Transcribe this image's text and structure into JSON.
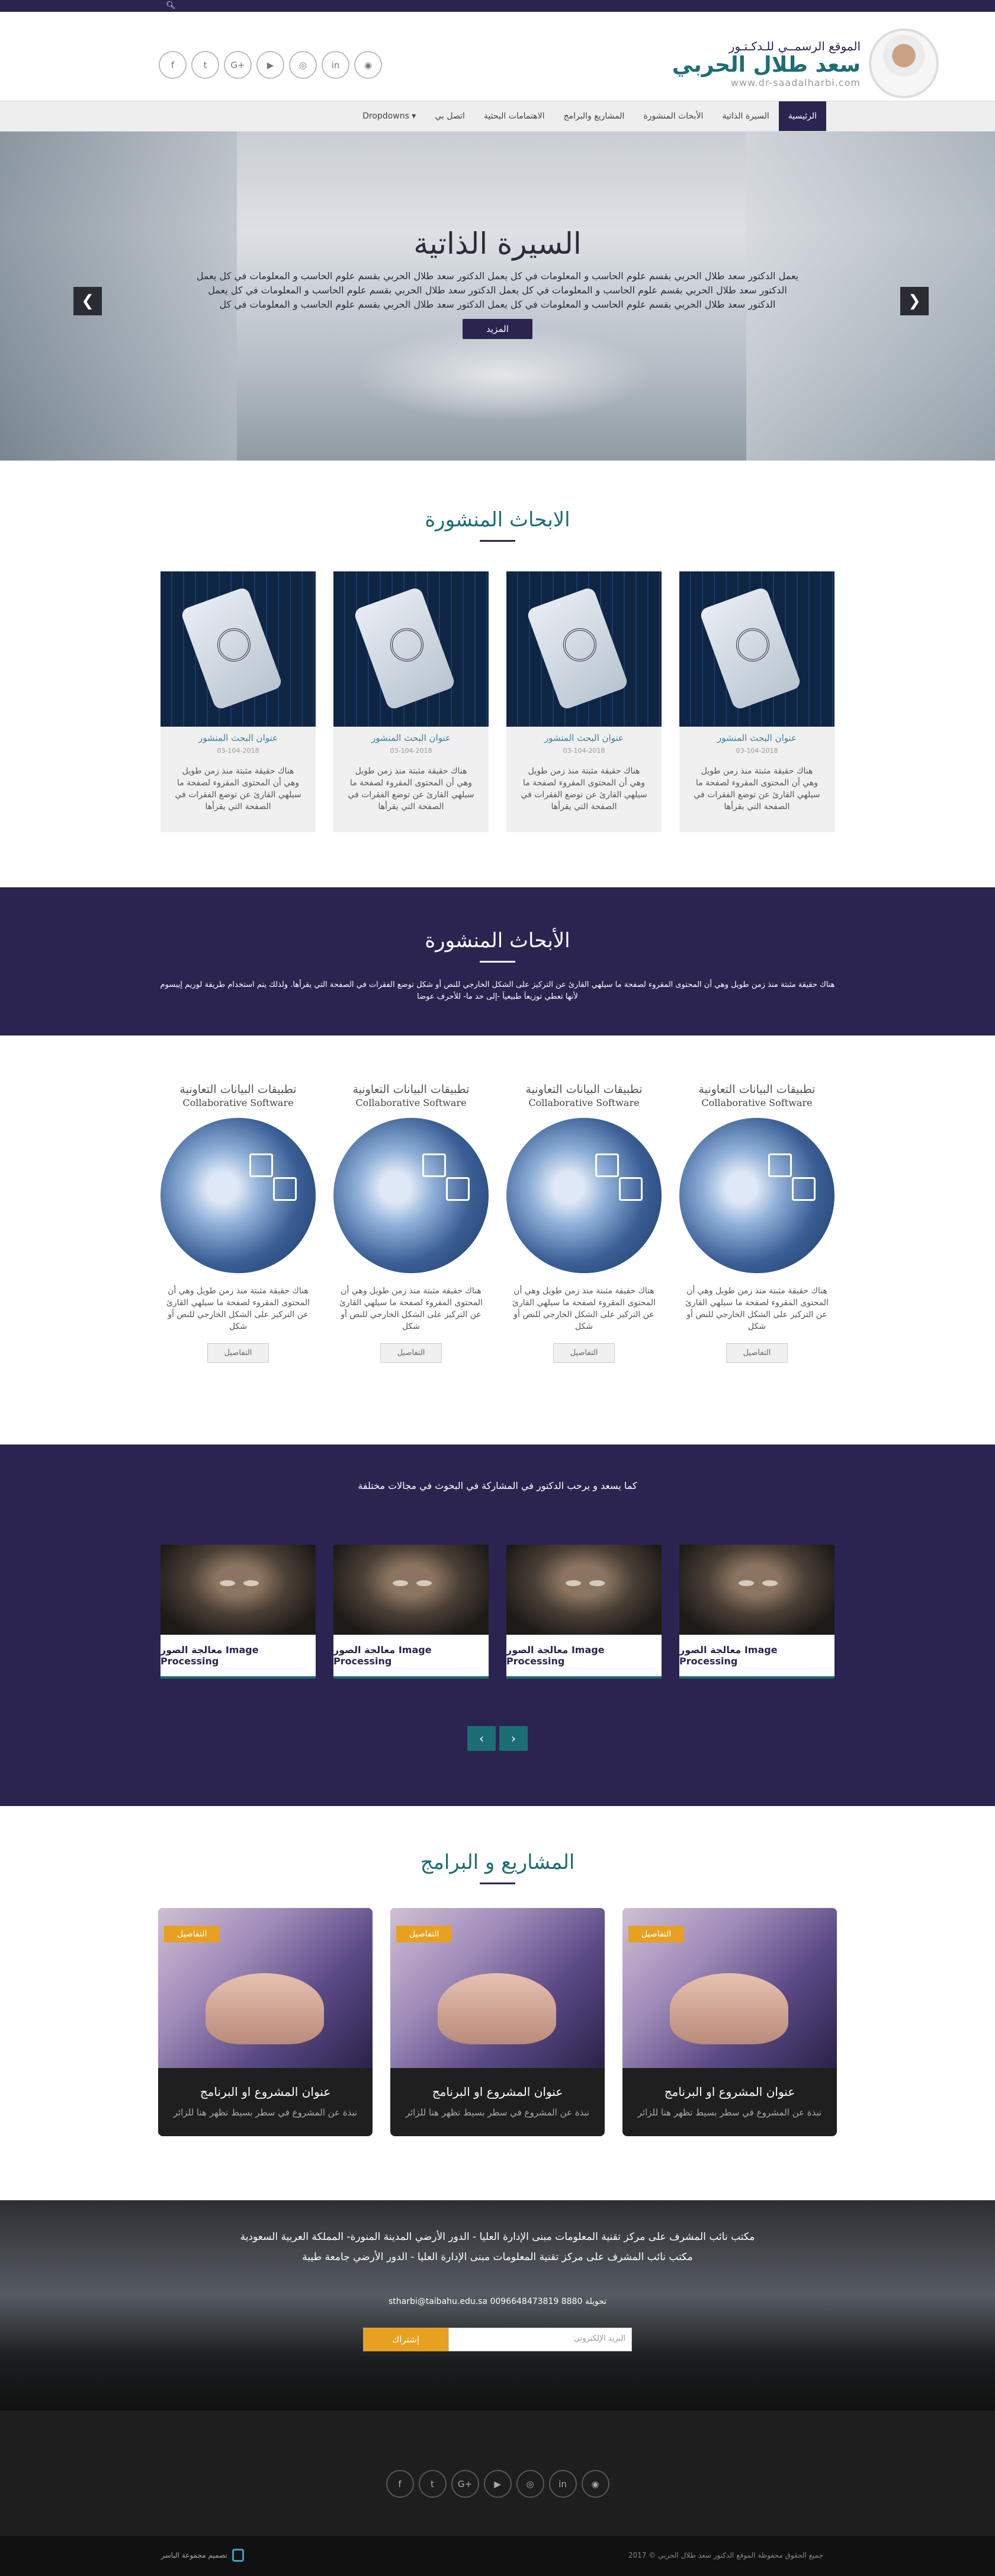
{
  "topbar": {
    "search_icon": "search-icon"
  },
  "header": {
    "logo_line1": "الموقع الرسمــي للـدكـتـور",
    "logo_name": "سعد طلال الحربي",
    "logo_domain": "www.dr-saadalharbi.com",
    "socials": [
      "f",
      "t",
      "G+",
      "▶",
      "◎",
      "in",
      "◉"
    ],
    "social_icons": [
      "facebook-icon",
      "twitter-icon",
      "google-plus-icon",
      "youtube-icon",
      "instagram-icon",
      "linkedin-icon",
      "rss-icon"
    ]
  },
  "nav": {
    "items": [
      "الرئيسية",
      "السيرة الذاتية",
      "الأبحاث المنشورة",
      "المشاريع والبرامج",
      "الاهتمامات البحثية",
      "اتصل بي",
      "Dropdowns ▾"
    ]
  },
  "hero": {
    "title": "السيرة الذاتية",
    "text": "يعمل الدكتور سعد طلال الحربي بقسم علوم الحاسب و المعلومات في كل يعمل الدكتور سعد طلال الحربي بقسم علوم الحاسب و المعلومات في كل يعمل الدكتور سعد طلال الحربي بقسم علوم الحاسب و المعلومات في كل يعمل الدكتور سعد طلال الحربي بقسم علوم الحاسب و المعلومات في كل يعمل الدكتور سعد طلال الحربي بقسم علوم الحاسب و المعلومات في كل يعمل الدكتور سعد طلال الحربي بقسم علوم الحاسب و المعلومات في كل",
    "button": "المزيد",
    "prev": "❮",
    "next": "❯"
  },
  "papers": {
    "title": "الابحاث المنشورة",
    "cards": [
      {
        "title": "عنوان البحث المنشور",
        "date": "03-104-2018",
        "text": "هناك حقيقة مثبتة منذ زمن طويل وهي أن المحتوى المقروء لصفحة ما سيلهي القارئ عن توضع الفقرات في الصفحة التي يقرأها"
      },
      {
        "title": "عنوان البحث المنشور",
        "date": "03-104-2018",
        "text": "هناك حقيقة مثبتة منذ زمن طويل وهي أن المحتوى المقروء لصفحة ما سيلهي القارئ عن توضع الفقرات في الصفحة التي يقرأها"
      },
      {
        "title": "عنوان البحث المنشور",
        "date": "03-104-2018",
        "text": "هناك حقيقة مثبتة منذ زمن طويل وهي أن المحتوى المقروء لصفحة ما سيلهي القارئ عن توضع الفقرات في الصفحة التي يقرأها"
      },
      {
        "title": "عنوان البحث المنشور",
        "date": "03-104-2018",
        "text": "هناك حقيقة مثبتة منذ زمن طويل وهي أن المحتوى المقروء لصفحة ما سيلهي القارئ عن توضع الفقرات في الصفحة التي يقرأها"
      }
    ]
  },
  "band": {
    "title": "الأبحاث المنشورة",
    "text": "هناك حقيقة مثبتة منذ زمن طويل وهي أن المحتوى المقروء لصفحة ما سيلهي القارئ عن التركيز على الشكل الخارجي للنص أو شكل توضع الفقرات في الصفحة التي يقرأها. ولذلك يتم استخدام طريقة لوريم إيبسوم لأنها تعطي توزيعاَ طبيعياَ -إلى حد ما- للأحرف عوضا"
  },
  "collab": {
    "cards": [
      {
        "title_ar": "تطبيقات البيانات التعاونية",
        "title_en": "Collaborative Software",
        "text": "هناك حقيقة مثبتة منذ زمن طويل وهي أن المحتوى المقروء لصفحة ما سيلهي القارئ عن التركيز على الشكل الخارجي للنص أو شكل",
        "button": "التفاصيل"
      },
      {
        "title_ar": "تطبيقات البيانات التعاونية",
        "title_en": "Collaborative Software",
        "text": "هناك حقيقة مثبتة منذ زمن طويل وهي أن المحتوى المقروء لصفحة ما سيلهي القارئ عن التركيز على الشكل الخارجي للنص أو شكل",
        "button": "التفاصيل"
      },
      {
        "title_ar": "تطبيقات البيانات التعاونية",
        "title_en": "Collaborative Software",
        "text": "هناك حقيقة مثبتة منذ زمن طويل وهي أن المحتوى المقروء لصفحة ما سيلهي القارئ عن التركيز على الشكل الخارجي للنص أو شكل",
        "button": "التفاصيل"
      },
      {
        "title_ar": "تطبيقات البيانات التعاونية",
        "title_en": "Collaborative Software",
        "text": "هناك حقيقة مثبتة منذ زمن طويل وهي أن المحتوى المقروء لصفحة ما سيلهي القارئ عن التركيز على الشكل الخارجي للنص أو شكل",
        "button": "التفاصيل"
      }
    ]
  },
  "research": {
    "subtitle": "كما يسعد و يرحب الدكتور في المشاركة في البحوث في مجالات مختلفة",
    "cards": [
      "معالجة الصور Image Processing",
      "معالجة الصور Image Processing",
      "معالجة الصور Image Processing",
      "معالجة الصور Image Processing"
    ],
    "prev": "‹",
    "next": "›"
  },
  "projects": {
    "title": "المشاريع و البرامج",
    "cards": [
      {
        "tag": "التفاصيل",
        "title": "عنوان المشروع او البرنامج",
        "text": "نبذة عن المشروع في سطر بسيط تظهر هنا للزائر"
      },
      {
        "tag": "التفاصيل",
        "title": "عنوان المشروع او البرنامج",
        "text": "نبذة عن المشروع في سطر بسيط تظهر هنا للزائر"
      },
      {
        "tag": "التفاصيل",
        "title": "عنوان المشروع او البرنامج",
        "text": "نبذة عن المشروع في سطر بسيط تظهر هنا للزائر"
      }
    ]
  },
  "footer": {
    "address1": "مكتب نائب المشرف على مركز تقنية المعلومات مبنى الإدارة العليا - الدور الأرضي المدينة المنورة- المملكة العربية السعودية",
    "address2": "مكتب نائب المشرف على مركز تقنية المعلومات مبنى الإدارة العليا - الدور الأرضي جامعة طيبة",
    "contact": "stharbi@taibahu.edu.sa   0096648473819 تحويلة 8880",
    "email_placeholder": "البريد الإلكتروني",
    "subscribe": "إشتراك",
    "copyright": "جميع الحقوق محفوظة الموقع الدكتور سعد طلال الحربي © 2017",
    "designer": "تصميم مجموعة الباسر"
  }
}
